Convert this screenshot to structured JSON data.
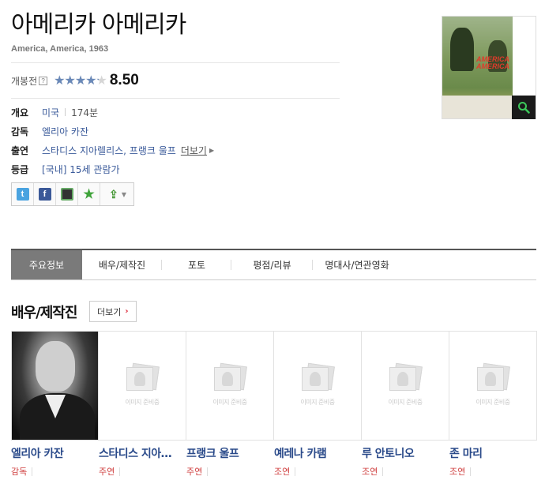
{
  "movie": {
    "title": "아메리카 아메리카",
    "subtitle": "America, America, 1963",
    "rating_label": "개봉전",
    "help_icon": "?",
    "rating_stars_filled": 4.25,
    "rating_stars_total": 5,
    "rating_score": "8.50"
  },
  "info": {
    "overview_label": "개요",
    "country": "미국",
    "runtime": "174분",
    "director_label": "감독",
    "director": "엘리아 카잔",
    "cast_label": "출연",
    "cast": "스타디스 지아렐리스, 프랭크 울프",
    "cast_more": "더보기",
    "grade_label": "등급",
    "grade": "[국내] 15세 관람가"
  },
  "share": {
    "icons": [
      "twitter-icon",
      "facebook-icon",
      "cyworld-icon",
      "favorite-star-icon",
      "share-icon"
    ]
  },
  "poster": {
    "title_text": "AMERICA AMERICA",
    "zoom_icon": "magnifier-icon"
  },
  "tabs": [
    {
      "label": "주요정보",
      "active": true
    },
    {
      "label": "배우/제작진",
      "active": false
    },
    {
      "label": "포토",
      "active": false
    },
    {
      "label": "평점/리뷰",
      "active": false
    },
    {
      "label": "명대사/연관영화",
      "active": false
    }
  ],
  "cast_section": {
    "title": "배우/제작진",
    "more_label": "더보기",
    "more_arrow": "›",
    "placeholder_text": "이미지 준비중",
    "people": [
      {
        "name": "엘리아 카잔",
        "role": "감독",
        "has_photo": true
      },
      {
        "name": "스타디스 지아렐리스",
        "role": "주연",
        "has_photo": false
      },
      {
        "name": "프랭크 울프",
        "role": "주연",
        "has_photo": false
      },
      {
        "name": "예레나 카램",
        "role": "조연",
        "has_photo": false
      },
      {
        "name": "루 안토니오",
        "role": "조연",
        "has_photo": false
      },
      {
        "name": "존 마리",
        "role": "조연",
        "has_photo": false
      }
    ]
  },
  "colors": {
    "link_blue": "#3a5a9a",
    "name_blue": "#2a4a8a",
    "role_red": "#d04040",
    "star_fill": "#6a89b8",
    "tab_active_bg": "#7a7a7a"
  }
}
